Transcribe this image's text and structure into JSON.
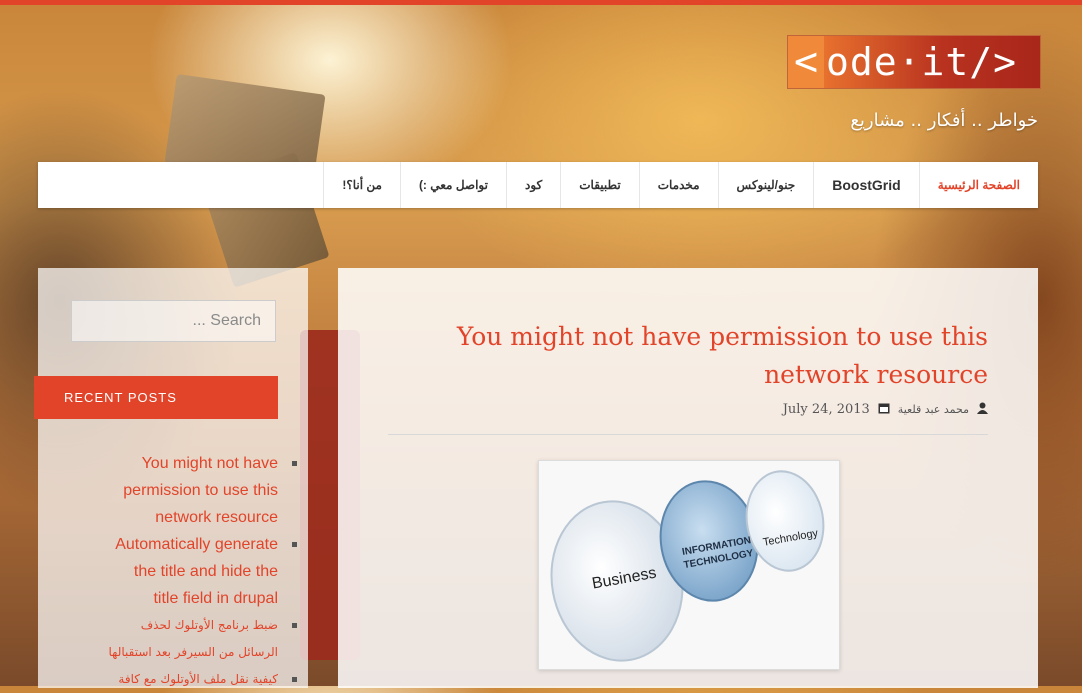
{
  "logo": {
    "part1": "<",
    "part2": "ode·it/>"
  },
  "tagline": "خواطر .. أفكار .. مشاريع",
  "nav": {
    "items": [
      {
        "label": "الصفحة الرئيسية"
      },
      {
        "label": "BoostGrid"
      },
      {
        "label": "جنو/لينوكس"
      },
      {
        "label": "مخدمات"
      },
      {
        "label": "تطبيقات"
      },
      {
        "label": "كود"
      },
      {
        "label": "تواصل معي :)"
      },
      {
        "label": "من أنا؟!"
      }
    ]
  },
  "sidebar": {
    "search_placeholder": "Search ...",
    "recent_posts_title": "RECENT POSTS",
    "posts": [
      {
        "title": "You might not have permission to use this network resource"
      },
      {
        "title": "Automatically generate the title and hide the title field in drupal"
      },
      {
        "title": "ضبط برنامج الأوتلوك لحذف الرسائل من السيرفر بعد استقبالها"
      },
      {
        "title": "كيفية نقل ملف الأوتلوك مع كافة"
      }
    ]
  },
  "post": {
    "title": "You might not have permission to use this network resource",
    "author": "محمد عبد قلعية",
    "date": "July 24, 2013",
    "image": {
      "label_business": "Business",
      "label_it_1": "INFORMATION",
      "label_it_2": "TECHNOLOGY",
      "label_tech": "Technology"
    }
  },
  "colors": {
    "accent": "#e2442a",
    "nav_bg": "#ffffff"
  }
}
